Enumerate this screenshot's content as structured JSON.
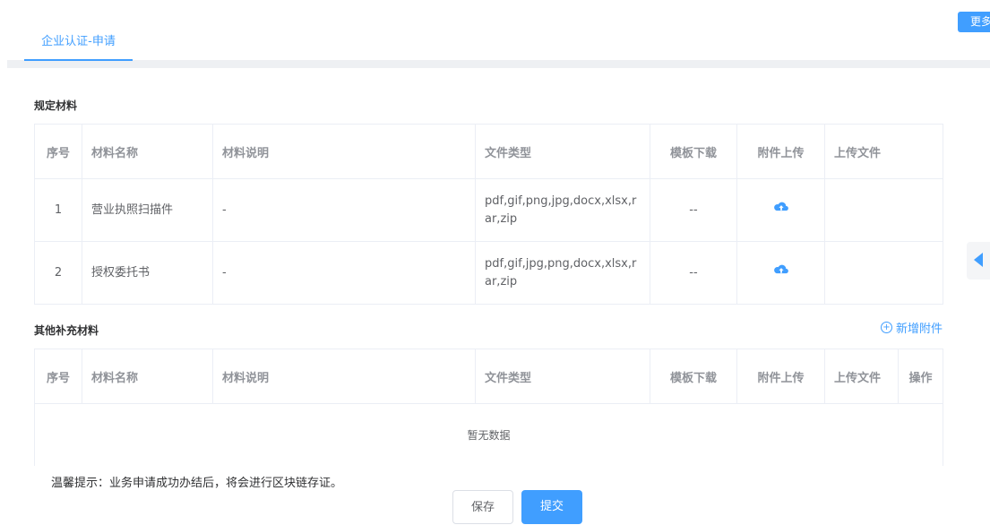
{
  "header": {
    "tab_label": "企业认证-申请",
    "more_button": "更多"
  },
  "required": {
    "title": "规定材料",
    "columns": [
      "序号",
      "材料名称",
      "材料说明",
      "文件类型",
      "模板下载",
      "附件上传",
      "上传文件"
    ],
    "rows": [
      {
        "index": "1",
        "name": "营业执照扫描件",
        "desc": "-",
        "types": "pdf,gif,png,jpg,docx,xlsx,rar,zip",
        "template": "--"
      },
      {
        "index": "2",
        "name": "授权委托书",
        "desc": "-",
        "types": "pdf,gif,jpg,png,docx,xlsx,rar,zip",
        "template": "--"
      }
    ]
  },
  "other": {
    "title": "其他补充材料",
    "add_label": "新增附件",
    "columns": [
      "序号",
      "材料名称",
      "材料说明",
      "文件类型",
      "模板下载",
      "附件上传",
      "上传文件",
      "操作"
    ],
    "empty_text": "暂无数据"
  },
  "footer": {
    "tip": "温馨提示：业务申请成功办结后，将会进行区块链存证。",
    "save": "保存",
    "submit": "提交"
  },
  "colors": {
    "accent": "#409eff",
    "border": "#ebeef5",
    "header_text": "#909399"
  },
  "icons": {
    "upload": "cloud-upload-icon",
    "add": "plus-circle-icon",
    "side": "caret-left-icon"
  }
}
